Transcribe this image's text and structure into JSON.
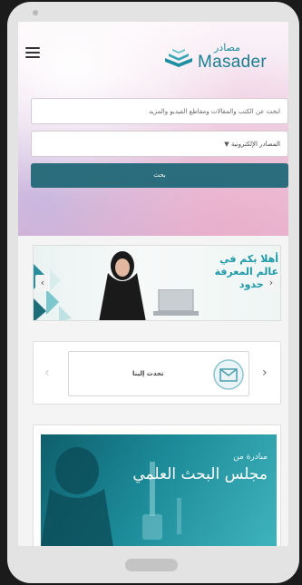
{
  "app": {
    "logo_arabic": "مصادر",
    "logo_english": "Masader"
  },
  "search": {
    "placeholder": "ابحث عن الكتب والمقالات ومقاطع الفيديو والمزيد",
    "source_select": "المصادر الإلكترونية",
    "button_label": "بحث"
  },
  "banner": {
    "text": "أهلا بكم في عالم المعرفة بلا حدود"
  },
  "contact": {
    "label": "تحدث إلينا"
  },
  "initiative": {
    "small_text": "مبادرة من",
    "title": "مجلس البحث العلمي"
  },
  "colors": {
    "accent": "#2b6d7c",
    "brand_teal": "#1f9aa8"
  }
}
